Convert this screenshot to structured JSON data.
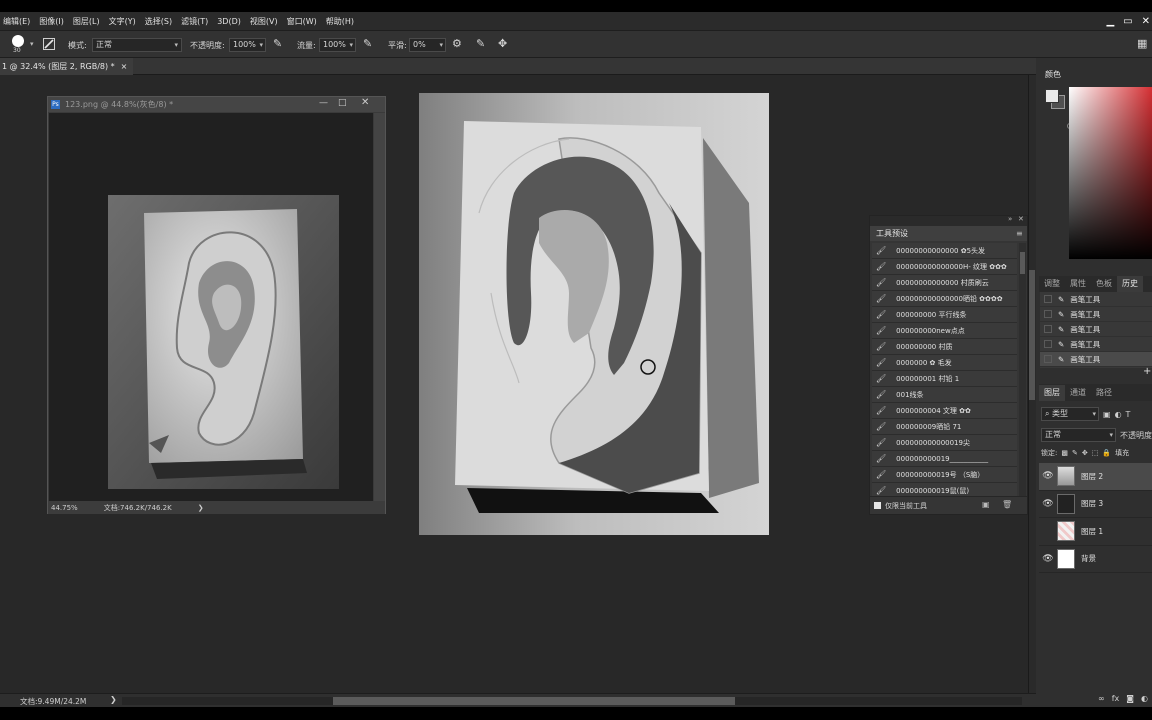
{
  "menu": [
    "编辑(E)",
    "图像(I)",
    "图层(L)",
    "文字(Y)",
    "选择(S)",
    "滤镜(T)",
    "3D(D)",
    "视图(V)",
    "窗口(W)",
    "帮助(H)"
  ],
  "options_bar": {
    "brush_size": "30",
    "mode_label": "模式:",
    "mode_value": "正常",
    "opacity_label": "不透明度:",
    "opacity_value": "100%",
    "flow_label": "流量:",
    "flow_value": "100%",
    "smoothing_label": "平滑:",
    "smoothing_value": "0%"
  },
  "document_tab": {
    "title": "1 @ 32.4% (图层 2, RGB/8) *",
    "close": "×"
  },
  "float_window": {
    "title": "123.png @ 44.8%(灰色/8) *",
    "zoom": "44.75%",
    "doc_info": "文档:746.2K/746.2K",
    "arrow": "❯"
  },
  "tool_presets": {
    "title": "工具预设",
    "items": [
      "00000000000000 ✿5头发",
      "000000000000000H- 纹理 ✿✿✿",
      "00000000000000 村质刷云",
      "000000000000000晒铅 ✿✿✿✿",
      "000000000 平行线条",
      "000000000new点点",
      "000000000 村质",
      "0000000 ✿ 毛发",
      "000000001 村铅 1",
      "001线条",
      "0000000004 文理 ✿✿",
      "000000009晒铅 71",
      "000000000000019尖",
      "000000000019___________",
      "000000000019号 （S脑）",
      "000000000019鼠(鼠)"
    ],
    "footer_checkbox_label": "仅限当前工具"
  },
  "color_panel": {
    "title": "颜色"
  },
  "adjust_tabs": [
    "调整",
    "属性",
    "色板",
    "历史"
  ],
  "history": {
    "items": [
      "画笔工具",
      "画笔工具",
      "画笔工具",
      "画笔工具",
      "画笔工具"
    ],
    "selected_index": 4
  },
  "layers_panel": {
    "tabs": [
      "图层",
      "通道",
      "路径"
    ],
    "filter_label": "类型",
    "blend_mode": "正常",
    "opacity_label": "不透明度",
    "lock_label": "锁定:",
    "fill_label": "填充",
    "layers": [
      {
        "name": "图层 2",
        "visible": true,
        "selected": true
      },
      {
        "name": "图层 3",
        "visible": true,
        "selected": false
      },
      {
        "name": "图层 1",
        "visible": false,
        "selected": false
      },
      {
        "name": "背景",
        "visible": true,
        "selected": false
      }
    ]
  },
  "status_bar": {
    "doc_info": "文档:9.49M/24.2M",
    "arrow": "❯"
  },
  "colors": {
    "accent_red": "#d52f33",
    "ui_dark": "#282828"
  }
}
